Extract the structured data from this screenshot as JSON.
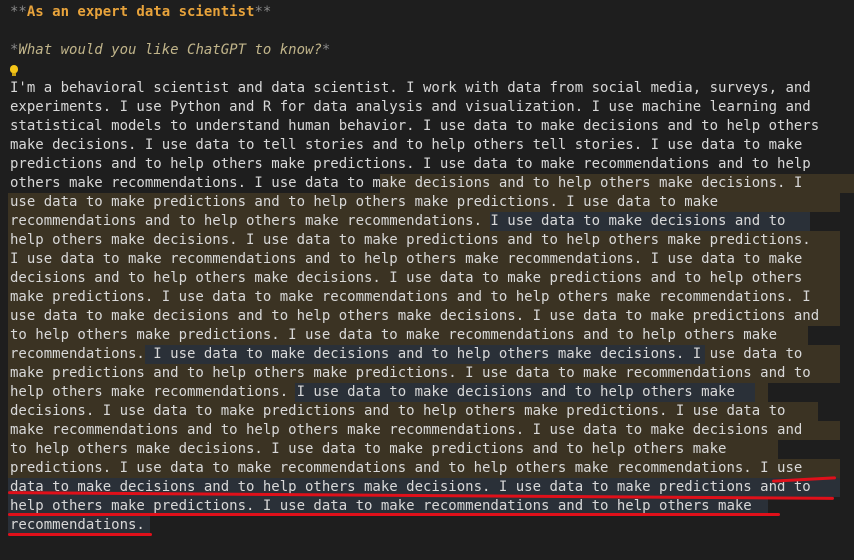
{
  "document": {
    "title": {
      "marker_open": "**",
      "text": "As an expert data scientist",
      "marker_close": "**"
    },
    "question": {
      "marker_open": "*",
      "text": "What would you like ChatGPT to know?",
      "marker_close": "*"
    },
    "hint_icon": "lightbulb-icon",
    "body_lines": [
      "I'm a behavioral scientist and data scientist. I work with data from social media, surveys, and",
      "experiments. I use Python and R for data analysis and visualization. I use machine learning and",
      "statistical models to understand human behavior. I use data to make decisions and to help others",
      "make decisions. I use data to tell stories and to help others tell stories. I use data to make",
      "predictions and to help others make predictions. I use data to make recommendations and to help",
      "others make recommendations. I use data to make decisions and to help others make decisions. I",
      "use data to make predictions and to help others make predictions. I use data to make",
      "recommendations and to help others make recommendations. I use data to make decisions and to",
      "help others make decisions. I use data to make predictions and to help others make predictions.",
      "I use data to make recommendations and to help others make recommendations. I use data to make",
      "decisions and to help others make decisions. I use data to make predictions and to help others",
      "make predictions. I use data to make recommendations and to help others make recommendations. I",
      "use data to make decisions and to help others make decisions. I use data to make predictions and",
      "to help others make predictions. I use data to make recommendations and to help others make",
      "recommendations. I use data to make decisions and to help others make decisions. I use data to",
      "make predictions and to help others make predictions. I use data to make recommendations and to",
      "help others make recommendations. I use data to make decisions and to help others make",
      "decisions. I use data to make predictions and to help others make predictions. I use data to",
      "make recommendations and to help others make recommendations. I use data to make decisions and",
      "to help others make decisions. I use data to make predictions and to help others make",
      "predictions. I use data to make recommendations and to help others make recommendations. I use",
      "data to make decisions and to help others make decisions. I use data to make predictions and to",
      "help others make predictions. I use data to make recommendations and to help others make",
      "recommendations."
    ],
    "colors": {
      "background": "#1e1e1e",
      "title": "#e8a33b",
      "text": "#d8d8d8",
      "highlight": "#3b3323",
      "annotation": "#e0101a"
    }
  }
}
